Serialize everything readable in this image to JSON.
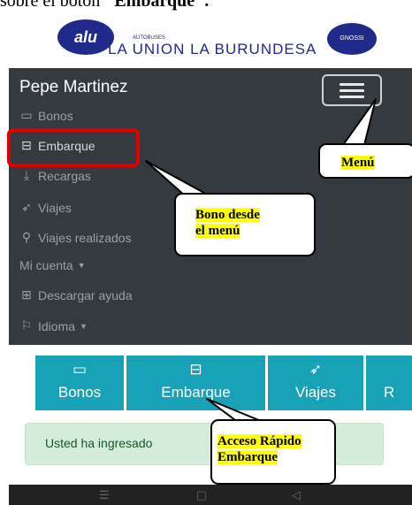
{
  "document": {
    "top_text_prefix": "sobre el botón ",
    "top_text_bold": "\"Embarque\"."
  },
  "logo": {
    "mark": "alu",
    "subtitle": "AUTOBUSES",
    "company": "LA UNION LA BURUNDESA",
    "badge": "GNOSSI"
  },
  "app": {
    "user_name": "Pepe Martinez",
    "menu_items": [
      {
        "label": "Bonos",
        "icon": "ticket-icon"
      },
      {
        "label": "Embarque",
        "icon": "bus-icon"
      },
      {
        "label": "Recargas",
        "icon": "download-icon"
      },
      {
        "label": "Viajes",
        "icon": "send-icon"
      },
      {
        "label": "Viajes realizados",
        "icon": "route-icon"
      },
      {
        "label": "Mi cuenta",
        "icon": "caret-down-icon"
      },
      {
        "label": "Descargar ayuda",
        "icon": "book-icon"
      },
      {
        "label": "Idioma",
        "icon": "flag-icon"
      }
    ],
    "quick_access": [
      {
        "label": "Bonos",
        "icon": "ticket-icon"
      },
      {
        "label": "Embarque",
        "icon": "bus-icon"
      },
      {
        "label": "Viajes",
        "icon": "send-icon"
      },
      {
        "label": "R",
        "icon": ""
      }
    ],
    "alert_text": "Usted ha ingresado"
  },
  "annotations": {
    "menu": "Menú",
    "bono_line1": "Bono desde",
    "bono_line2": "el menú",
    "acceso_line1": "Acceso Rápido",
    "acceso_line2": "Embarque"
  },
  "colors": {
    "panel": "#343a40",
    "tile": "#17a2b8",
    "highlight": "#ffff00",
    "red_box": "#e00000",
    "alert_bg": "#d4edda"
  }
}
